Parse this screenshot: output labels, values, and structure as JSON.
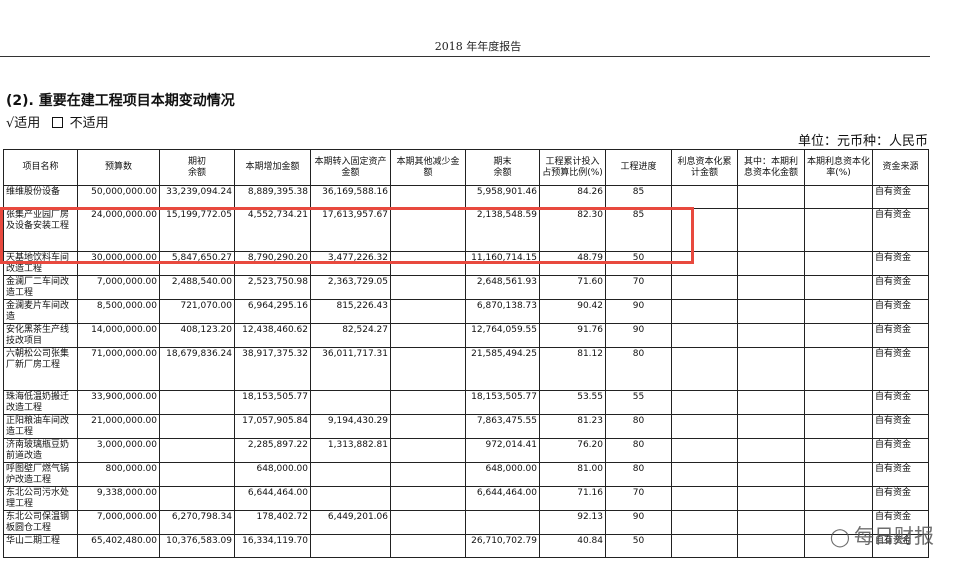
{
  "header": {
    "title": "2018 年年度报告"
  },
  "section": {
    "title": "(2). 重要在建工程项目本期变动情况"
  },
  "applicability": {
    "checked_label": "√适用",
    "unchecked_label": "不适用"
  },
  "unit_line": "单位：元币种：人民币",
  "table": {
    "headers": [
      "项目名称",
      "预算数",
      "期初\n余额",
      "本期增加金额",
      "本期转入固定资产金额",
      "本期其他减少金额",
      "期末\n余额",
      "工程累计投入占预算比例(%)",
      "工程进度",
      "利息资本化累计金额",
      "其中：本期利息资本化金额",
      "本期利息资本化率(%)",
      "资金来源"
    ],
    "rows": [
      {
        "name": "维维股份设备",
        "budget": "50,000,000.00",
        "opening": "33,239,094.24",
        "increase": "8,889,395.38",
        "to_fixed": "36,169,588.16",
        "other": "",
        "closing": "5,958,901.46",
        "ratio": "84.26",
        "progress": "85",
        "cap_total": "",
        "cap_period": "",
        "cap_rate": "",
        "source": "自有资金"
      },
      {
        "name": "张集产业园厂房及设备安装工程",
        "budget": "24,000,000.00",
        "opening": "15,199,772.05",
        "increase": "4,552,734.21",
        "to_fixed": "17,613,957.67",
        "other": "",
        "closing": "2,138,548.59",
        "ratio": "82.30",
        "progress": "85",
        "cap_total": "",
        "cap_period": "",
        "cap_rate": "",
        "source": "自有资金"
      },
      {
        "name": "天基地饮料车间改造工程",
        "budget": "30,000,000.00",
        "opening": "5,847,650.27",
        "increase": "8,790,290.20",
        "to_fixed": "3,477,226.32",
        "other": "",
        "closing": "11,160,714.15",
        "ratio": "48.79",
        "progress": "50",
        "cap_total": "",
        "cap_period": "",
        "cap_rate": "",
        "source": "自有资金"
      },
      {
        "name": "金澜厂二车间改造工程",
        "budget": "7,000,000.00",
        "opening": "2,488,540.00",
        "increase": "2,523,750.98",
        "to_fixed": "2,363,729.05",
        "other": "",
        "closing": "2,648,561.93",
        "ratio": "71.60",
        "progress": "70",
        "cap_total": "",
        "cap_period": "",
        "cap_rate": "",
        "source": "自有资金"
      },
      {
        "name": "金澜麦片车间改造",
        "budget": "8,500,000.00",
        "opening": "721,070.00",
        "increase": "6,964,295.16",
        "to_fixed": "815,226.43",
        "other": "",
        "closing": "6,870,138.73",
        "ratio": "90.42",
        "progress": "90",
        "cap_total": "",
        "cap_period": "",
        "cap_rate": "",
        "source": "自有资金"
      },
      {
        "name": "安化黑茶生产线技改项目",
        "budget": "14,000,000.00",
        "opening": "408,123.20",
        "increase": "12,438,460.62",
        "to_fixed": "82,524.27",
        "other": "",
        "closing": "12,764,059.55",
        "ratio": "91.76",
        "progress": "90",
        "cap_total": "",
        "cap_period": "",
        "cap_rate": "",
        "source": "自有资金"
      },
      {
        "name": "六朝松公司张集厂新厂房工程",
        "budget": "71,000,000.00",
        "opening": "18,679,836.24",
        "increase": "38,917,375.32",
        "to_fixed": "36,011,717.31",
        "other": "",
        "closing": "21,585,494.25",
        "ratio": "81.12",
        "progress": "80",
        "cap_total": "",
        "cap_period": "",
        "cap_rate": "",
        "source": "自有资金"
      },
      {
        "name": "珠海低温奶搬迁改造工程",
        "budget": "33,900,000.00",
        "opening": "",
        "increase": "18,153,505.77",
        "to_fixed": "",
        "other": "",
        "closing": "18,153,505.77",
        "ratio": "53.55",
        "progress": "55",
        "cap_total": "",
        "cap_period": "",
        "cap_rate": "",
        "source": "自有资金"
      },
      {
        "name": "正阳粮油车间改造工程",
        "budget": "21,000,000.00",
        "opening": "",
        "increase": "17,057,905.84",
        "to_fixed": "9,194,430.29",
        "other": "",
        "closing": "7,863,475.55",
        "ratio": "81.23",
        "progress": "80",
        "cap_total": "",
        "cap_period": "",
        "cap_rate": "",
        "source": "自有资金"
      },
      {
        "name": "济南玻璃瓶豆奶前道改造",
        "budget": "3,000,000.00",
        "opening": "",
        "increase": "2,285,897.22",
        "to_fixed": "1,313,882.81",
        "other": "",
        "closing": "972,014.41",
        "ratio": "76.20",
        "progress": "80",
        "cap_total": "",
        "cap_period": "",
        "cap_rate": "",
        "source": "自有资金"
      },
      {
        "name": "呼图壁厂燃气锅炉改造工程",
        "budget": "800,000.00",
        "opening": "",
        "increase": "648,000.00",
        "to_fixed": "",
        "other": "",
        "closing": "648,000.00",
        "ratio": "81.00",
        "progress": "80",
        "cap_total": "",
        "cap_period": "",
        "cap_rate": "",
        "source": "自有资金"
      },
      {
        "name": "东北公司污水处理工程",
        "budget": "9,338,000.00",
        "opening": "",
        "increase": "6,644,464.00",
        "to_fixed": "",
        "other": "",
        "closing": "6,644,464.00",
        "ratio": "71.16",
        "progress": "70",
        "cap_total": "",
        "cap_period": "",
        "cap_rate": "",
        "source": "自有资金"
      },
      {
        "name": "东北公司保温钢板圆仓工程",
        "budget": "7,000,000.00",
        "opening": "6,270,798.34",
        "increase": "178,402.72",
        "to_fixed": "6,449,201.06",
        "other": "",
        "closing": "",
        "ratio": "92.13",
        "progress": "90",
        "cap_total": "",
        "cap_period": "",
        "cap_rate": "",
        "source": "自有资金"
      },
      {
        "name": "华山二期工程",
        "budget": "65,402,480.00",
        "opening": "10,376,583.09",
        "increase": "16,334,119.70",
        "to_fixed": "",
        "other": "",
        "closing": "26,710,702.79",
        "ratio": "40.84",
        "progress": "50",
        "cap_total": "",
        "cap_period": "",
        "cap_rate": "",
        "source": "自有资金"
      }
    ]
  },
  "watermark": {
    "text": "每日财报",
    "icon": "wechat-icon"
  },
  "colors": {
    "highlight": "#e8493e"
  }
}
